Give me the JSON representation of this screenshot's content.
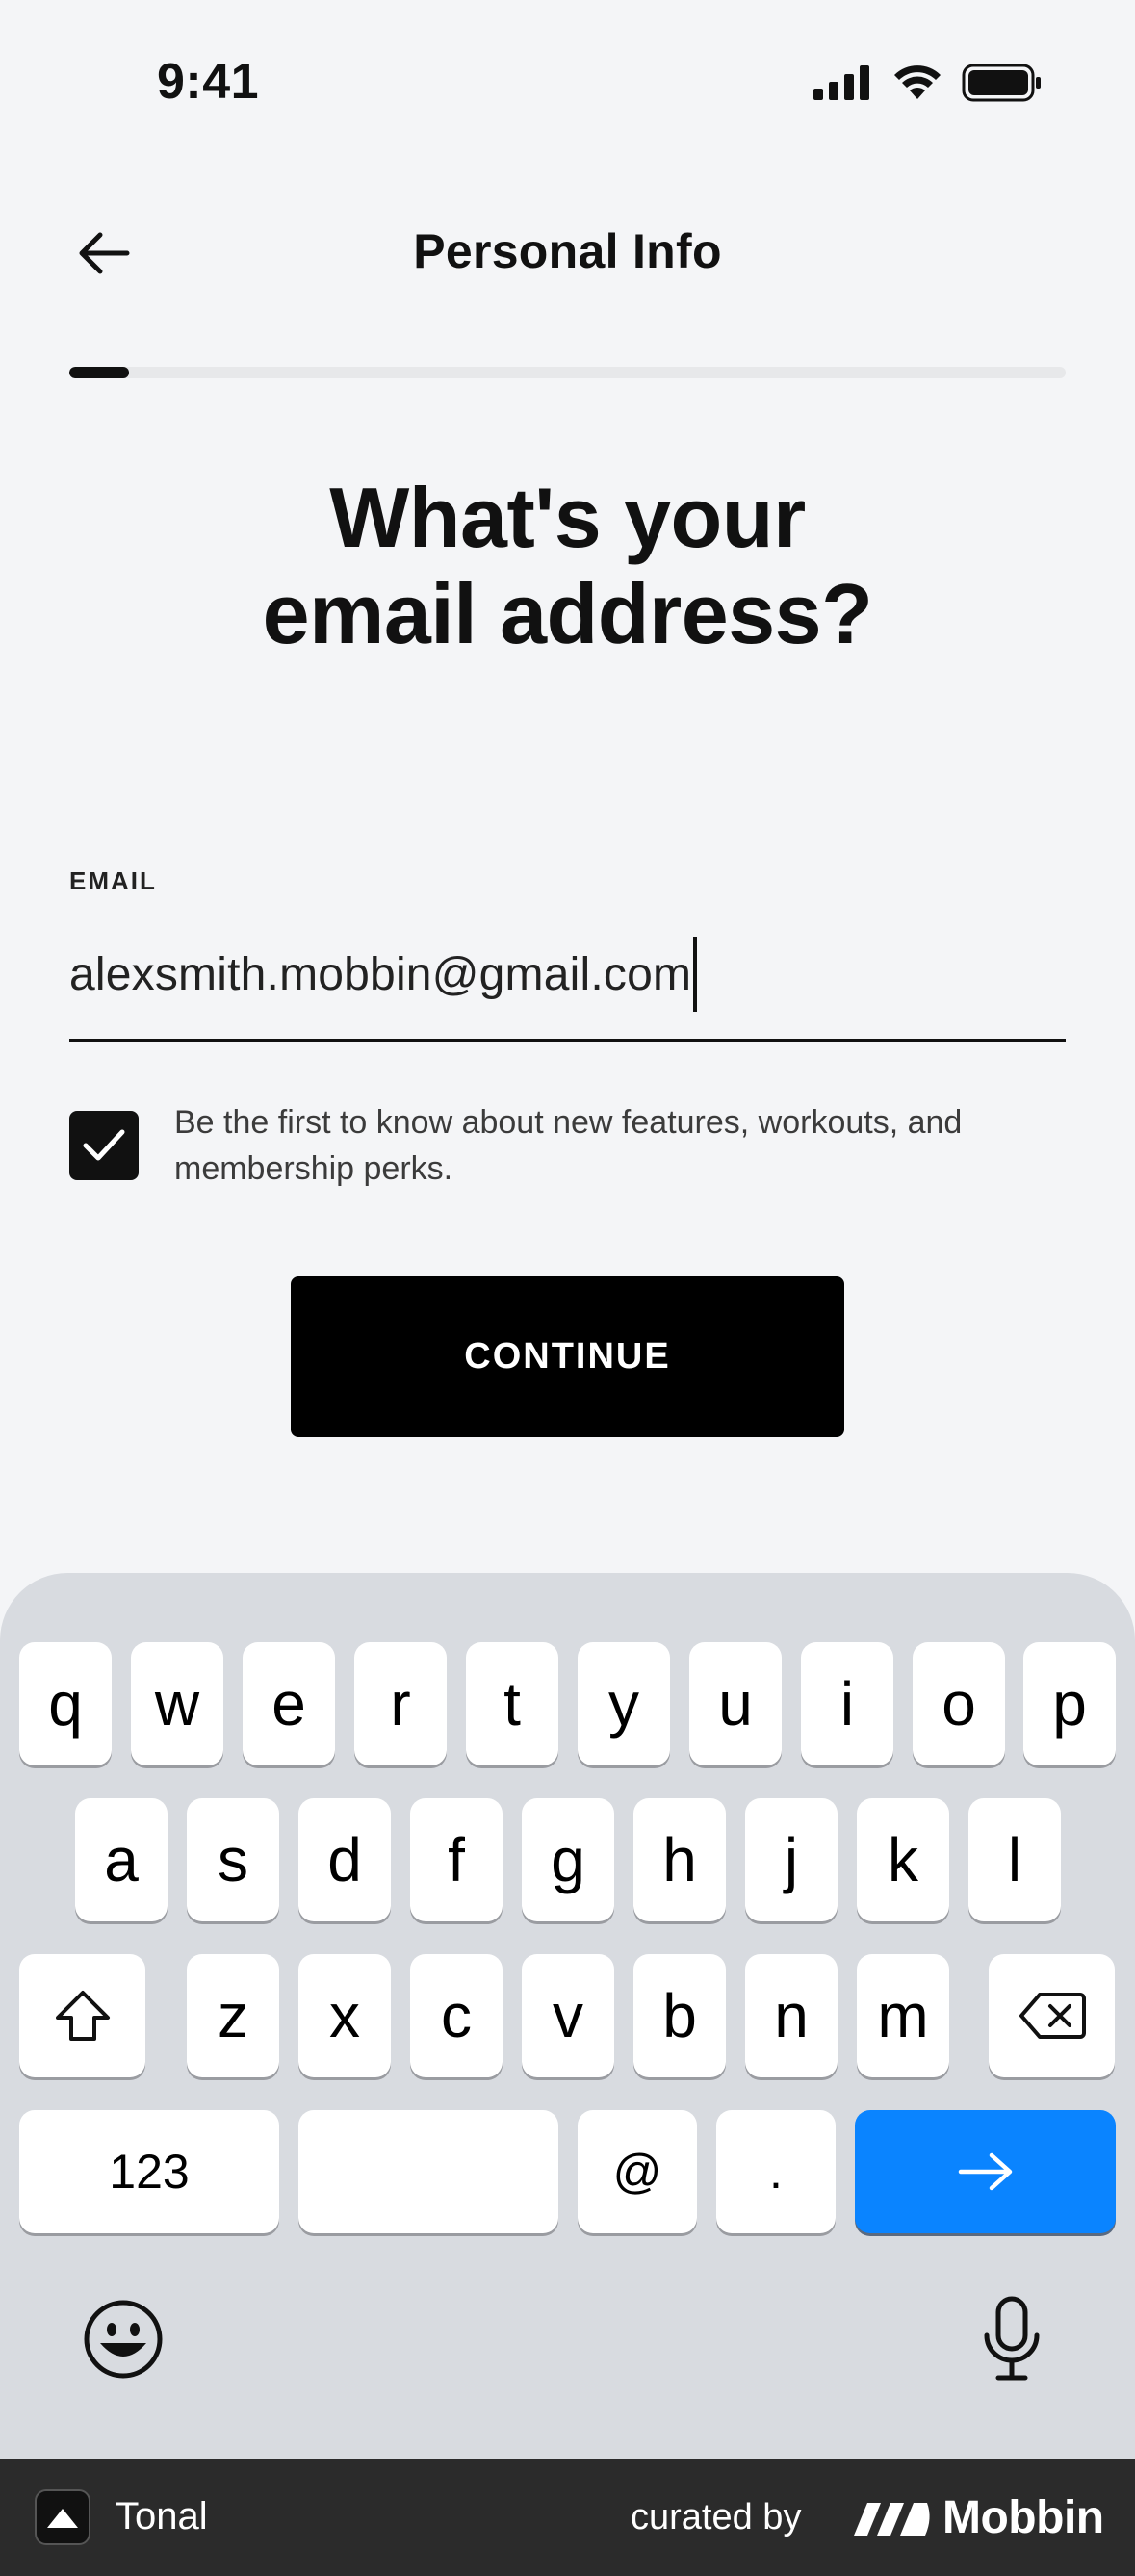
{
  "status_bar": {
    "time": "9:41"
  },
  "header": {
    "title": "Personal Info"
  },
  "progress": {
    "fraction": 0.06
  },
  "question": {
    "line1": "What's your",
    "line2": "email address?"
  },
  "email": {
    "label": "EMAIL",
    "value": "alexsmith.mobbin@gmail.com"
  },
  "opt_in": {
    "checked": true,
    "label": "Be the first to know about new features, workouts, and membership perks."
  },
  "continue_label": "CONTINUE",
  "keyboard": {
    "row1": [
      "q",
      "w",
      "e",
      "r",
      "t",
      "y",
      "u",
      "i",
      "o",
      "p"
    ],
    "row2": [
      "a",
      "s",
      "d",
      "f",
      "g",
      "h",
      "j",
      "k",
      "l"
    ],
    "row3": [
      "z",
      "x",
      "c",
      "v",
      "b",
      "n",
      "m"
    ],
    "numbers_label": "123",
    "at_label": "@",
    "dot_label": ".",
    "go_color": "#0a84ff"
  },
  "footer": {
    "app_name": "Tonal",
    "curated_by": "curated by",
    "brand": "Mobbin"
  }
}
